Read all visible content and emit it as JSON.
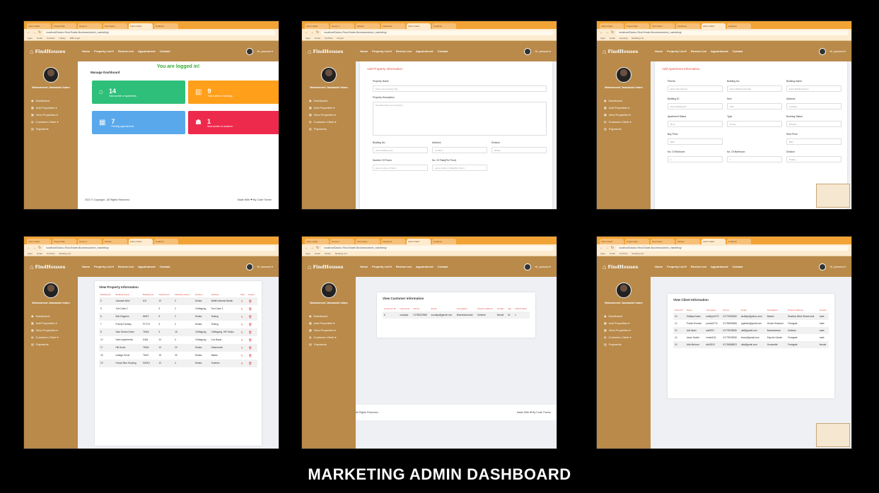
{
  "caption": "MARKETING ADMIN DASHBOARD",
  "app": {
    "logo": "FindHouses",
    "nav": [
      "Home",
      "Property List ▾",
      "Review List",
      "Appointment",
      "Contact"
    ],
    "user": "Hi, jawwad ▾",
    "profile_name": "Mohammed Jawwadul Islam",
    "sidebar": [
      {
        "icon": "dashboard-icon",
        "glyph": "◉",
        "label": "Dashboard"
      },
      {
        "icon": "add-icon",
        "glyph": "▦",
        "label": "Add Properties ▾"
      },
      {
        "icon": "view-icon",
        "glyph": "▦",
        "label": "View Properties ▾"
      },
      {
        "icon": "user-icon",
        "glyph": "◍",
        "label": "Customer-Client ▾"
      },
      {
        "icon": "payment-icon",
        "glyph": "▤",
        "label": "Payments"
      }
    ]
  },
  "browser": {
    "url": "localhost/Dadoo-Real-Estate-Business/admin_marketing/",
    "bookmarks": [
      "Apps",
      "Gmail",
      "YouTube",
      "Library",
      "Learning",
      "SMS Login",
      "Project",
      "Reading List"
    ],
    "tabs": [
      "Admin Dash",
      "Project Man",
      "Group 4",
      "Team Mem",
      "Modern",
      "Facebook",
      "Admin Dash",
      "localhost"
    ]
  },
  "dashboard": {
    "logged_in": "You are logged in!",
    "heading": "Manage Dashboard",
    "stats": [
      {
        "value": "14",
        "label": "Total number of apartments",
        "color": "#2ebf7a",
        "icon": "building-icon",
        "glyph": "⌂"
      },
      {
        "value": "9",
        "label": "Total number of buildings",
        "color": "#ff9f1a",
        "icon": "tower-icon",
        "glyph": "▥"
      },
      {
        "value": "7",
        "label": "Pending appointments",
        "color": "#5aa8ec",
        "icon": "calendar-icon",
        "glyph": "▦"
      },
      {
        "value": "1",
        "label": "Total number of customer",
        "color": "#ee2a4c",
        "icon": "people-icon",
        "glyph": "☗"
      }
    ],
    "footer_left": "2021 © Copyright - All Rights Reserved.",
    "footer_right": "Made With ❤ By Code Theme"
  },
  "add_property": {
    "title": "Add Property Information",
    "property_name_label": "Property Name",
    "property_name_ph": "Enter your property title",
    "description_label": "Property Description",
    "description_ph": "Describe about your property",
    "building_label": "Building No.",
    "building_ph": "enter building num",
    "address_label": "Address",
    "address_ph": "Location",
    "division_label": "Division",
    "division_ph": "Dhaka",
    "floors_label": "Number Of Floors",
    "floors_ph": "enter number of floors",
    "flats_label": "No. Of Flats(Per Floor)",
    "flats_ph": "enter number of flats(Per Floor)"
  },
  "add_apartment": {
    "title": "Add Apartment Information",
    "fields": [
      {
        "label": "Flat No.",
        "ph": "Enter Flat Number"
      },
      {
        "label": "Building No.",
        "ph": "Enter Building Number"
      },
      {
        "label": "Building Name",
        "ph": "Enter Building Name"
      },
      {
        "label": "Building ID",
        "ph": "Enter Building ID"
      },
      {
        "label": "Size",
        "ph": "Sqft"
      },
      {
        "label": "Address",
        "ph": "Location"
      },
      {
        "label": "Apartment Status",
        "ph": "Rent"
      },
      {
        "label": "Type",
        "ph": "House"
      },
      {
        "label": "Booking Status",
        "ph": "Booked"
      },
      {
        "label": "Buy Price",
        "ph": "BDT"
      },
      {
        "label": "",
        "ph": ""
      },
      {
        "label": "Rent Price",
        "ph": "BDT"
      },
      {
        "label": "No. Of Bedroom",
        "ph": "1"
      },
      {
        "label": "No. Of Bathroom",
        "ph": "1"
      },
      {
        "label": "Division",
        "ph": "Dhaka"
      }
    ]
  },
  "view_property": {
    "title": "View Property Information",
    "headers": [
      "Building ID",
      "Building Name",
      "Building No",
      "Total Floors",
      "Flats(Per Floor)",
      "Division",
      "Address",
      "Edit",
      "Delete"
    ],
    "rows": [
      [
        "3",
        "Jawwadl Istim",
        "A11",
        "10",
        "3",
        "Dhaka",
        "Malibl Ahsmas Baddu"
      ],
      [
        "5",
        "Tool Case 2",
        "",
        "5",
        "2",
        "Chittagong",
        "Tool Case 2"
      ],
      [
        "6",
        "Bult Kingdom",
        "NMF1",
        "5",
        "2",
        "Dhaka",
        "Testing"
      ],
      [
        "7",
        "Priority Fantasy",
        "PCTV1",
        "5",
        "2",
        "Dhaka",
        "Testing"
      ],
      [
        "8",
        "Sam Dream Home",
        "TMA3",
        "5",
        "15",
        "Chittagong",
        "Chittagong- Hill Tracks"
      ],
      [
        "12",
        "Kabir Apartments",
        "K464",
        "10",
        "4",
        "Chittagong",
        "Cox Bazar"
      ],
      [
        "17",
        "Hill Home",
        "TMA3",
        "10",
        "20",
        "Dhaka",
        "Dhanmondi"
      ],
      [
        "18",
        "cottage Home",
        "TMA7",
        "15",
        "30",
        "Dhaka",
        "Baddu"
      ],
      [
        "19",
        "House Blue Housing",
        "HAS01",
        "10",
        "4",
        "Dhaka",
        "Gulshan"
      ]
    ]
  },
  "view_customer": {
    "title": "View Customer Information",
    "headers": [
      "Customer ID",
      "Username",
      "Phone",
      "Email",
      "Occupation",
      "Present Address",
      "Gender",
      "Age",
      "Authorization"
    ],
    "rows": [
      [
        "6",
        "sumaiya",
        "01756322569",
        "sumaiya@gmail.com",
        "Businesswoman",
        "Gulshan",
        "female",
        "42",
        "✔"
      ]
    ],
    "footer_left": "All Rights Reserved.",
    "footer_right": "Made With ❤ By Code Theme"
  },
  "view_client": {
    "title": "View Client Information",
    "headers": [
      "Client ID",
      "Name",
      "Username",
      "Phone",
      "Email",
      "Occupation",
      "Present Address",
      "Gender"
    ],
    "rows": [
      [
        "10",
        "Shafiqul Islam",
        "shafiqul1273",
        "01779453469",
        "shafiqul@yahoo.com",
        "Banker",
        "Shankar West Dhanmondi",
        "male"
      ],
      [
        "12",
        "Pranto Roshan",
        "pranto3719",
        "01753699568",
        "ppabbin@gmail.com",
        "House Husband",
        "Farmgate",
        "male"
      ],
      [
        "13",
        "Asif Islam",
        "asif4917",
        "01775033536",
        "asif@gmail.com",
        "Businessman",
        "Gulshan",
        "male"
      ],
      [
        "14",
        "Imran Sarker",
        "imran5111",
        "01775033536",
        "imran@gmail.com",
        "Esports Gamer",
        "Farmgate",
        "male"
      ],
      [
        "15",
        "Afia Mehzna",
        "afia7819",
        "01754588523",
        "afia@gmail.com",
        "Housewife",
        "Farmgate",
        "female"
      ]
    ]
  }
}
